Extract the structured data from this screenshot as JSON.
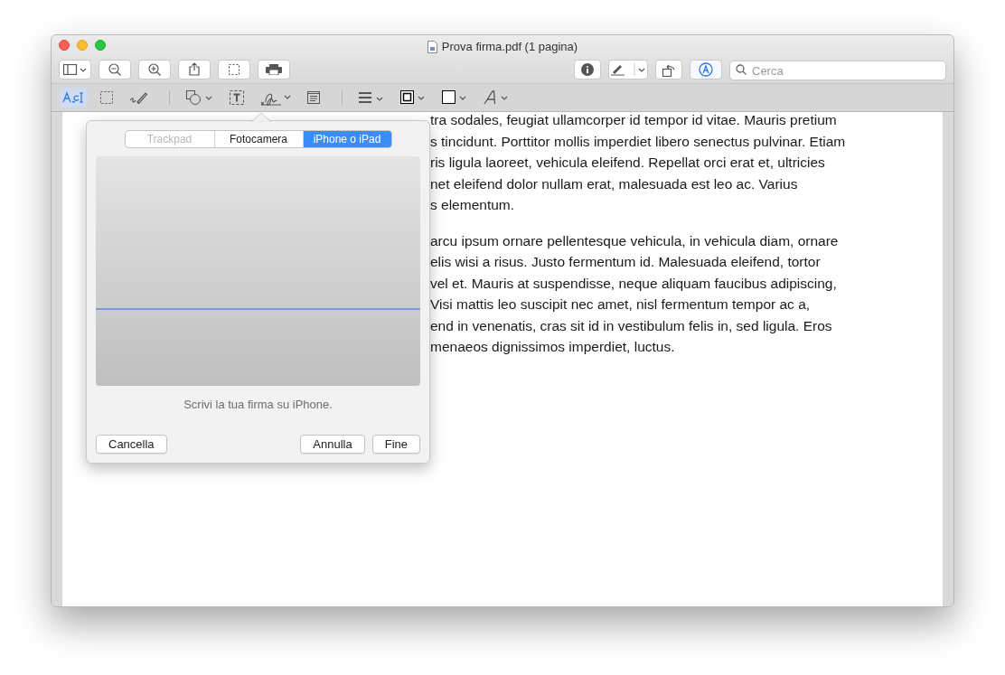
{
  "window": {
    "title": "Prova firma.pdf (1 pagina)"
  },
  "toolbar": {
    "left": [
      {
        "kind": "sidebar"
      },
      {
        "kind": "zoom-out"
      },
      {
        "kind": "zoom-in"
      },
      {
        "kind": "share"
      },
      {
        "kind": "select"
      },
      {
        "kind": "print"
      }
    ],
    "right": [
      {
        "kind": "info",
        "selected": false
      },
      {
        "kind": "highlight",
        "selected": false
      },
      {
        "kind": "rotate",
        "selected": false
      },
      {
        "kind": "markup",
        "selected": true
      }
    ],
    "search": {
      "placeholder": "Cerca"
    }
  },
  "markup_tools": [
    {
      "kind": "text-select",
      "selected": true
    },
    {
      "kind": "rect-select",
      "selected": false
    },
    {
      "kind": "sketch",
      "selected": false
    },
    {
      "kind": "shapes",
      "selected": false
    },
    {
      "kind": "textbox",
      "selected": false
    },
    {
      "kind": "sign",
      "selected": false
    },
    {
      "kind": "note",
      "selected": false
    },
    {
      "kind": "line-style",
      "selected": false
    },
    {
      "kind": "border-color",
      "selected": false
    },
    {
      "kind": "fill-color",
      "selected": false
    },
    {
      "kind": "font",
      "selected": false
    }
  ],
  "document": {
    "paragraphs": [
      [
        "tra sodales, feugiat ullamcorper id tempor id vitae. Mauris pretium",
        "s tincidunt. Porttitor mollis imperdiet libero senectus pulvinar. Etiam",
        "ris ligula laoreet, vehicula eleifend. Repellat orci erat et, ultricies",
        "net eleifend dolor nullam erat, malesuada est leo ac. Varius",
        "s elementum."
      ],
      [
        "arcu ipsum ornare pellentesque vehicula, in vehicula diam, ornare",
        "elis wisi a risus. Justo fermentum id. Malesuada eleifend, tortor",
        "vel et. Mauris at suspendisse, neque aliquam faucibus adipiscing,",
        "Visi mattis leo suscipit nec amet, nisl fermentum tempor ac a,",
        "end in venenatis, cras sit id in vestibulum felis in, sed ligula. Eros",
        "menaeos dignissimos imperdiet, luctus."
      ]
    ]
  },
  "signature_popover": {
    "tabs": [
      {
        "label": "Trackpad",
        "selected": false,
        "disabled": true
      },
      {
        "label": "Fotocamera",
        "selected": false,
        "disabled": false
      },
      {
        "label": "iPhone o iPad",
        "selected": true,
        "disabled": false
      }
    ],
    "message": "Scrivi la tua firma su iPhone.",
    "buttons": [
      {
        "label": "Cancella",
        "kind": "left"
      },
      {
        "label": "Annulla",
        "kind": "right"
      },
      {
        "label": "Fine",
        "kind": "right"
      }
    ]
  }
}
